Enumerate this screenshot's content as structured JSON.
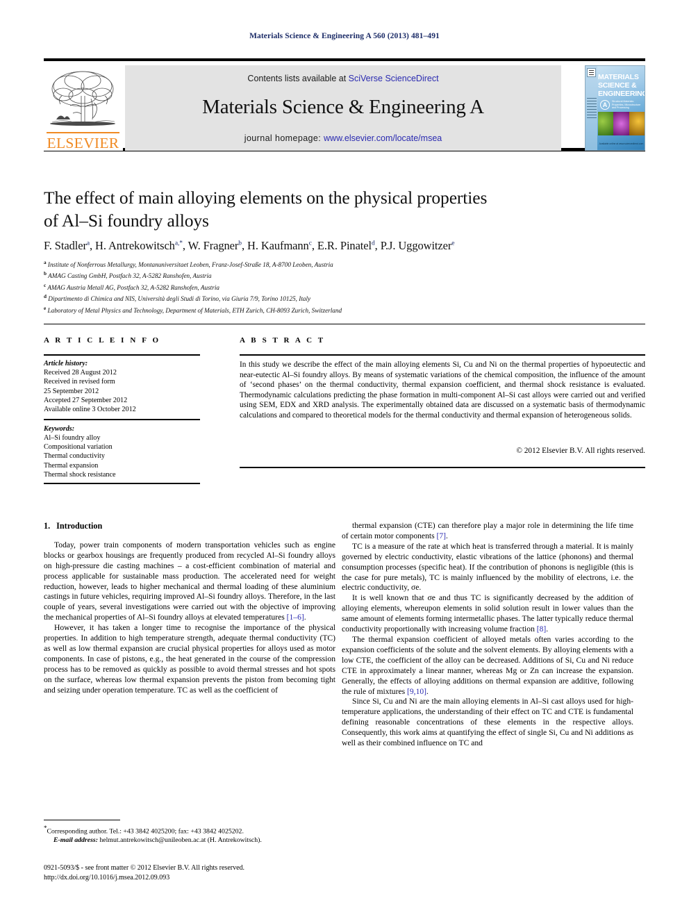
{
  "running_head": "Materials Science & Engineering A 560 (2013) 481–491",
  "masthead": {
    "publisher_logo_name": "elsevier-tree-logo",
    "publisher_wordmark": "ELSEVIER",
    "contents_prefix": "Contents lists available at ",
    "contents_link": "SciVerse ScienceDirect",
    "journal_name": "Materials Science & Engineering A",
    "homepage_prefix": "journal homepage: ",
    "homepage_url": "www.elsevier.com/locate/msea",
    "accent_link_color": "#2a2ab0",
    "elsevier_orange": "#F08A23",
    "panel_gray": "#e3e3e3",
    "cover": {
      "title_line1": "MATERIALS",
      "title_line2": "SCIENCE &",
      "title_line3": "ENGINEERING",
      "series_letter": "A",
      "subtitle": "Structural Materials: Properties, Microstructure and Processing",
      "footer": "Available online at www.sciencedirect.com"
    }
  },
  "article": {
    "title_line1": "The effect of main alloying elements on the physical properties",
    "title_line2": "of Al–Si foundry alloys",
    "authors": [
      {
        "name": "F. Stadler",
        "marks": "a",
        "sep": ", "
      },
      {
        "name": "H. Antrekowitsch",
        "marks": "a,*",
        "sep": ", "
      },
      {
        "name": "W. Fragner",
        "marks": "b",
        "sep": ", "
      },
      {
        "name": "H. Kaufmann",
        "marks": "c",
        "sep": ", "
      },
      {
        "name": "E.R. Pinatel",
        "marks": "d",
        "sep": ", "
      },
      {
        "name": "P.J. Uggowitzer",
        "marks": "e",
        "sep": ""
      }
    ],
    "affiliations": [
      {
        "mark": "a",
        "text": "Institute of Nonferrous Metallurgy, Montanuniversitaet Leoben, Franz-Josef-Straße 18, A-8700 Leoben, Austria"
      },
      {
        "mark": "b",
        "text": "AMAG Casting GmbH, Postfach 32, A-5282 Ranshofen, Austria"
      },
      {
        "mark": "c",
        "text": "AMAG Austria Metall AG, Postfach 32, A-5282 Ranshofen, Austria"
      },
      {
        "mark": "d",
        "text": "Dipartimento di Chimica and NIS, Università degli Studi di Torino, via Giuria 7/9, Torino 10125, Italy"
      },
      {
        "mark": "e",
        "text": "Laboratory of Metal Physics and Technology, Department of Materials, ETH Zurich, CH-8093 Zurich, Switzerland"
      }
    ]
  },
  "article_info": {
    "heading": "A R T I C L E  I N F O",
    "history_label": "Article history:",
    "history": [
      "Received 28 August 2012",
      "Received in revised form",
      "25 September 2012",
      "Accepted 27 September 2012",
      "Available online 3 October 2012"
    ],
    "keywords_label": "Keywords:",
    "keywords": [
      "Al–Si foundry alloy",
      "Compositional variation",
      "Thermal conductivity",
      "Thermal expansion",
      "Thermal shock resistance"
    ]
  },
  "abstract": {
    "heading": "A B S T R A C T",
    "text": "In this study we describe the effect of the main alloying elements Si, Cu and Ni on the thermal properties of hypoeutectic and near-eutectic Al–Si foundry alloys. By means of systematic variations of the chemical composition, the influence of the amount of ‘second phases’ on the thermal conductivity, thermal expansion coefficient, and thermal shock resistance is evaluated. Thermodynamic calculations predicting the phase formation in multi-component Al–Si cast alloys were carried out and verified using SEM, EDX and XRD analysis. The experimentally obtained data are discussed on a systematic basis of thermodynamic calculations and compared to theoretical models for the thermal conductivity and thermal expansion of heterogeneous solids.",
    "copyright": "© 2012 Elsevier B.V. All rights reserved."
  },
  "body": {
    "section_number": "1.",
    "section_title": "Introduction",
    "left_paragraphs": [
      "Today, power train components of modern transportation vehicles such as engine blocks or gearbox housings are frequently produced from recycled Al–Si foundry alloys on high-pressure die casting machines – a cost-efficient combination of material and process applicable for sustainable mass production. The accelerated need for weight reduction, however, leads to higher mechanical and thermal loading of these aluminium castings in future vehicles, requiring improved Al–Si foundry alloys. Therefore, in the last couple of years, several investigations were carried out with the objective of improving the mechanical properties of Al–Si foundry alloys at elevated temperatures [1–6].",
      "However, it has taken a longer time to recognise the importance of the physical properties. In addition to high temperature strength, adequate thermal conductivity (TC) as well as low thermal expansion are crucial physical properties for alloys used as motor components. In case of pistons, e.g., the heat generated in the course of the compression process has to be removed as quickly as possible to avoid thermal stresses and hot spots on the surface, whereas low thermal expansion prevents the piston from becoming tight and seizing under operation temperature. TC as well as the coefficient of"
    ],
    "right_paragraphs": [
      "thermal expansion (CTE) can therefore play a major role in determining the life time of certain motor components [7].",
      "TC is a measure of the rate at which heat is transferred through a material. It is mainly governed by electric conductivity, elastic vibrations of the lattice (phonons) and thermal consumption processes (specific heat). If the contribution of phonons is negligible (this is the case for pure metals), TC is mainly influenced by the mobility of electrons, i.e. the electric conductivity, σe.",
      "It is well known that σe and thus TC is significantly decreased by the addition of alloying elements, whereupon elements in solid solution result in lower values than the same amount of elements forming intermetallic phases. The latter typically reduce thermal conductivity proportionally with increasing volume fraction [8].",
      "The thermal expansion coefficient of alloyed metals often varies according to the expansion coefficients of the solute and the solvent elements. By alloying elements with a low CTE, the coefficient of the alloy can be decreased. Additions of Si, Cu and Ni reduce CTE in approximately a linear manner, whereas Mg or Zn can increase the expansion. Generally, the effects of alloying additions on thermal expansion are additive, following the rule of mixtures [9,10].",
      "Since Si, Cu and Ni are the main alloying elements in Al–Si cast alloys used for high-temperature applications, the understanding of their effect on TC and CTE is fundamental defining reasonable concentrations of these elements in the respective alloys. Consequently, this work aims at quantifying the effect of single Si, Cu and Ni additions as well as their combined influence on TC and"
    ],
    "inline_refs": [
      "[1–6]",
      "[7]",
      "[8]",
      "[9,10]"
    ]
  },
  "footnote": {
    "corresponding": "Corresponding author. Tel.: +43 3842 4025200; fax: +43 3842 4025202.",
    "email_label": "E-mail address:",
    "email": "helmut.antrekowitsch@unileoben.ac.at (H. Antrekowitsch)."
  },
  "imprint": {
    "line1": "0921-5093/$ - see front matter © 2012 Elsevier B.V. All rights reserved.",
    "line2": "http://dx.doi.org/10.1016/j.msea.2012.09.093"
  }
}
